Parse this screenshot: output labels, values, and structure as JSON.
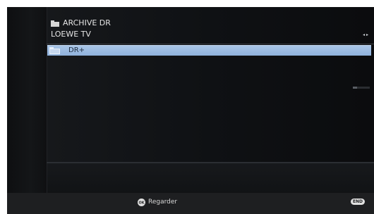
{
  "header": {
    "title": "ARCHIVE DR",
    "subtitle": "LOEWE TV",
    "nav_icon": "left-right-arrows-icon",
    "nav_glyph": "◂ ▸"
  },
  "list": {
    "items": [
      {
        "label": "DR+",
        "icon": "folder-icon",
        "selected": true
      }
    ]
  },
  "footer": {
    "ok_icon": "ok-button-icon",
    "ok_label": "Regarder",
    "end_key_label": "END"
  },
  "colors": {
    "selection": "#9dbde3",
    "background": "#101214",
    "text": "#e6e6e6"
  }
}
